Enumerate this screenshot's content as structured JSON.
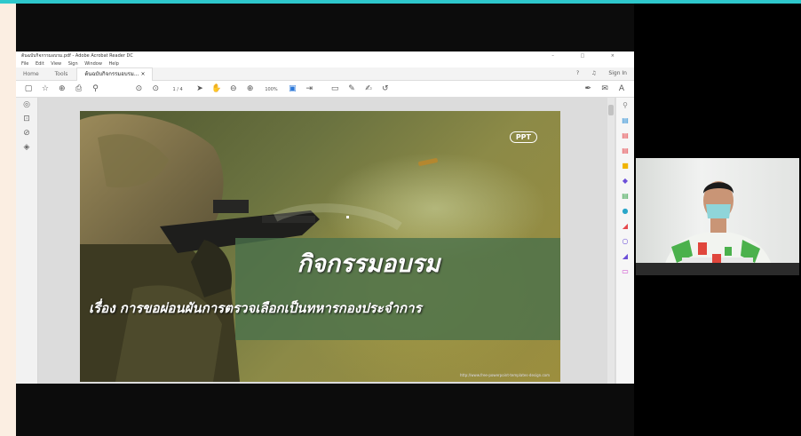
{
  "acrobat": {
    "window_title": "ต้นฉบับกิจกรรมอบรม.pdf - Adobe Acrobat Reader DC",
    "window_controls": "– □ ×",
    "menu": [
      "File",
      "Edit",
      "View",
      "Sign",
      "Window",
      "Help"
    ],
    "tabs": {
      "home": "Home",
      "tools": "Tools",
      "document": "ต้นฉบับกิจกรรมอบรม... ×"
    },
    "top_right": {
      "help": "?",
      "sign_in": "Sign In"
    },
    "toolbar": {
      "page_indicator": "1 / 4",
      "zoom": "100%"
    }
  },
  "slide": {
    "logo": "PPT",
    "title": "กิจกรรมอบรม",
    "subtitle": "เรื่อง การขอผ่อนผันการตรวจเลือกเป็นทหารกองประจำการ",
    "footnote": "http://www.free-powerpoint-templates-design.com"
  },
  "icons": {
    "left_rail": [
      "comment-icon",
      "bookmark-icon",
      "attachment-icon",
      "layers-icon"
    ],
    "right_rail": [
      "search-icon",
      "export-pdf-icon",
      "create-pdf-icon",
      "edit-pdf-icon",
      "comment-icon",
      "combine-files-icon",
      "organize-pages-icon",
      "enhance-scans-icon",
      "protect-icon",
      "fill-sign-icon",
      "send-for-review-icon",
      "more-tools-icon"
    ]
  }
}
